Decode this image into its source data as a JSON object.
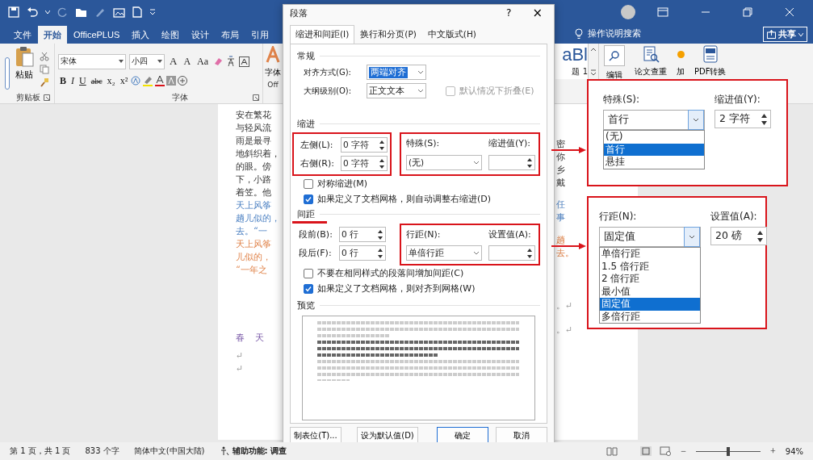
{
  "ribbon_tabs": [
    {
      "label": "文件",
      "selected": false
    },
    {
      "label": "开始",
      "selected": true
    },
    {
      "label": "OfficePLUS",
      "selected": false
    },
    {
      "label": "插入",
      "selected": false
    },
    {
      "label": "绘图",
      "selected": false
    },
    {
      "label": "设计",
      "selected": false
    },
    {
      "label": "布局",
      "selected": false
    },
    {
      "label": "引用",
      "selected": false
    }
  ],
  "tell_me": "操作说明搜索",
  "share": "共享",
  "ribbon": {
    "paste": "粘贴",
    "clipboard_label": "剪贴板",
    "font_name": "宋体",
    "font_size": "小四",
    "grow": "A",
    "shrink": "A",
    "change_case": "Aa",
    "format_buttons": [
      "B",
      "I",
      "U",
      "abc",
      "x₂",
      "x²"
    ],
    "font_label": "字体",
    "font_dialog_button": "字体",
    "office_label": "Off",
    "style_fragment": "aBl",
    "style_name": "题 1",
    "tools": [
      {
        "kind": "search",
        "label": "编辑"
      },
      {
        "kind": "check",
        "label": "论文查重"
      },
      {
        "kind": "dot",
        "label": "加"
      },
      {
        "kind": "pdf",
        "label": "PDF转换"
      }
    ]
  },
  "document": {
    "left_groups": [
      {
        "kind": "body",
        "lines": [
          "安在繁花",
          "与轻风流",
          "雨是最寻",
          "地斜织着，",
          "的眼。傍",
          "下，小路",
          "着笠。他"
        ]
      },
      {
        "kind": "quote",
        "lines": [
          "天上风筝",
          "趟儿似的，",
          "去。“一"
        ]
      },
      {
        "kind": "note",
        "lines": [
          "天上风筝",
          "儿似的，",
          "“一年之"
        ]
      },
      {
        "kind": "title",
        "lines": [
          "春 天"
        ]
      },
      {
        "kind": "mark",
        "lines": [
          "↵",
          "↵"
        ]
      }
    ],
    "right_groups": [
      {
        "kind": "body",
        "lines": [
          "密",
          "你",
          "乡",
          "戴"
        ]
      },
      {
        "kind": "quote",
        "lines": [
          "任",
          "事"
        ]
      },
      {
        "kind": "note",
        "lines": [
          "趟",
          "去。"
        ]
      },
      {
        "kind": "mark",
        "lines": [
          "。↵"
        ]
      },
      {
        "kind": "mark",
        "lines": [
          "。↵"
        ]
      }
    ]
  },
  "dialog": {
    "title": "段落",
    "help": "?",
    "close": "×",
    "tabs": [
      {
        "label": "缩进和间距(I)",
        "selected": true
      },
      {
        "label": "换行和分页(P)",
        "selected": false
      },
      {
        "label": "中文版式(H)",
        "selected": false
      }
    ],
    "general": {
      "heading": "常规",
      "alignment_label": "对齐方式(G):",
      "alignment": "两端对齐",
      "alignment_focused": true,
      "outline_label": "大纲级别(O):",
      "outline": "正文文本",
      "collapse": {
        "label": "默认情况下折叠(E)",
        "checked": false,
        "disabled": true
      }
    },
    "indent": {
      "heading": "缩进",
      "left_label": "左侧(L):",
      "left": "0 字符",
      "right_label": "右侧(R):",
      "right": "0 字符",
      "special_label": "特殊(S):",
      "special": "(无)",
      "by_label": "缩进值(Y):",
      "checks": [
        {
          "label": "对称缩进(M)",
          "checked": false
        },
        {
          "label": "如果定义了文档网格，则自动调整右缩进(D)",
          "checked": true
        }
      ]
    },
    "spacing": {
      "heading": "间距",
      "before_label": "段前(B):",
      "before": "0 行",
      "after_label": "段后(F):",
      "after": "0 行",
      "line_label": "行距(N):",
      "line": "单倍行距",
      "at_label": "设置值(A):",
      "checks": [
        {
          "label": "不要在相同样式的段落间增加间距(C)",
          "checked": false
        },
        {
          "label": "如果定义了文档网格，则对齐到网格(W)",
          "checked": true
        }
      ]
    },
    "preview_heading": "预览",
    "buttons": [
      {
        "label": "制表位(T)...",
        "default": false
      },
      {
        "label": "设为默认值(D)",
        "default": false
      },
      {
        "label": "确定",
        "default": true
      },
      {
        "label": "取消",
        "default": false
      }
    ]
  },
  "callouts": [
    {
      "label": "特殊(S):",
      "value": "首行",
      "value_label": "缩进值(Y):",
      "amount": "2 字符",
      "options": [
        {
          "label": "(无)",
          "selected": false
        },
        {
          "label": "首行",
          "selected": true
        },
        {
          "label": "悬挂",
          "selected": false
        }
      ]
    },
    {
      "label": "行距(N):",
      "value": "固定值",
      "value_label": "设置值(A):",
      "amount": "20 磅",
      "options": [
        {
          "label": "单倍行距",
          "selected": false
        },
        {
          "label": "1.5 倍行距",
          "selected": false
        },
        {
          "label": "2 倍行距",
          "selected": false
        },
        {
          "label": "最小值",
          "selected": false
        },
        {
          "label": "固定值",
          "selected": true
        },
        {
          "label": "多倍行距",
          "selected": false
        }
      ]
    }
  ],
  "status_bar": {
    "page": "第 1 页，共 1 页",
    "words": "833 个字",
    "language": "简体中文(中国大陆)",
    "accessibility": "辅助功能: 调查",
    "zoom_out": "−",
    "zoom_in": "+",
    "zoom": "94%",
    "level": 0.48
  }
}
